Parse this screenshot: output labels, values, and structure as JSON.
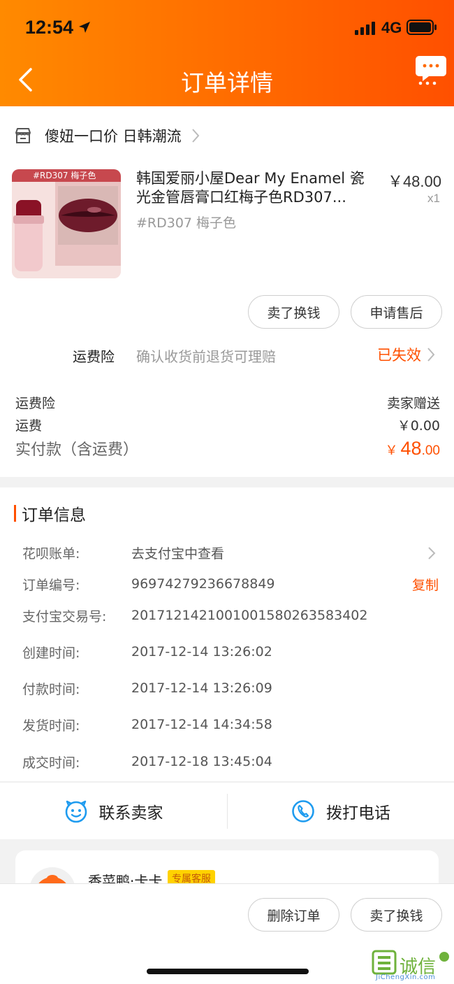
{
  "status_bar": {
    "time": "12:54",
    "network": "4G"
  },
  "header": {
    "title": "订单详情"
  },
  "shop": {
    "name": "傻妞一口价 日韩潮流"
  },
  "product": {
    "thumb_tag": "#RD307 梅子色",
    "title": "韩国爱丽小屋Dear My Enamel 瓷光金管唇膏口红梅子色RD307...",
    "sku": "#RD307 梅子色",
    "price": "￥48.00",
    "qty": "x1"
  },
  "actions": {
    "sell_label": "卖了换钱",
    "after_sale_label": "申请售后"
  },
  "insurance": {
    "label": "运费险",
    "desc": "确认收货前退货可理赔",
    "status": "已失效"
  },
  "fees": [
    {
      "label": "运费险",
      "value": "卖家赠送"
    },
    {
      "label": "运费",
      "value": "￥0.00"
    }
  ],
  "total": {
    "label": "实付款（含运费）",
    "symbol": "￥",
    "integer": "48",
    "decimal": ".00"
  },
  "order_info": {
    "title": "订单信息",
    "rows": [
      {
        "label": "花呗账单:",
        "value": "去支付宝中查看"
      },
      {
        "label": "订单编号:",
        "value": "96974279236678849",
        "action": "复制"
      },
      {
        "label": "支付宝交易号:",
        "value": "2017121421001001580263583402"
      },
      {
        "label": "创建时间:",
        "value": "2017-12-14 13:26:02"
      },
      {
        "label": "付款时间:",
        "value": "2017-12-14 13:26:09"
      },
      {
        "label": "发货时间:",
        "value": "2017-12-14 14:34:58"
      },
      {
        "label": "成交时间:",
        "value": "2017-12-18 13:45:04"
      }
    ]
  },
  "contact": {
    "seller_label": "联系卖家",
    "phone_label": "拨打电话"
  },
  "service": {
    "name": "香菜鸭·卡卡",
    "badge": "专属客服"
  },
  "bottom": {
    "delete_label": "删除订单",
    "sell_label": "卖了换钱"
  },
  "watermark": {
    "text": "诚信",
    "sub": "JiChengXin.com"
  },
  "colors": {
    "accent": "#ff5000",
    "header_start": "#ff8a00",
    "header_end": "#ff5000"
  }
}
